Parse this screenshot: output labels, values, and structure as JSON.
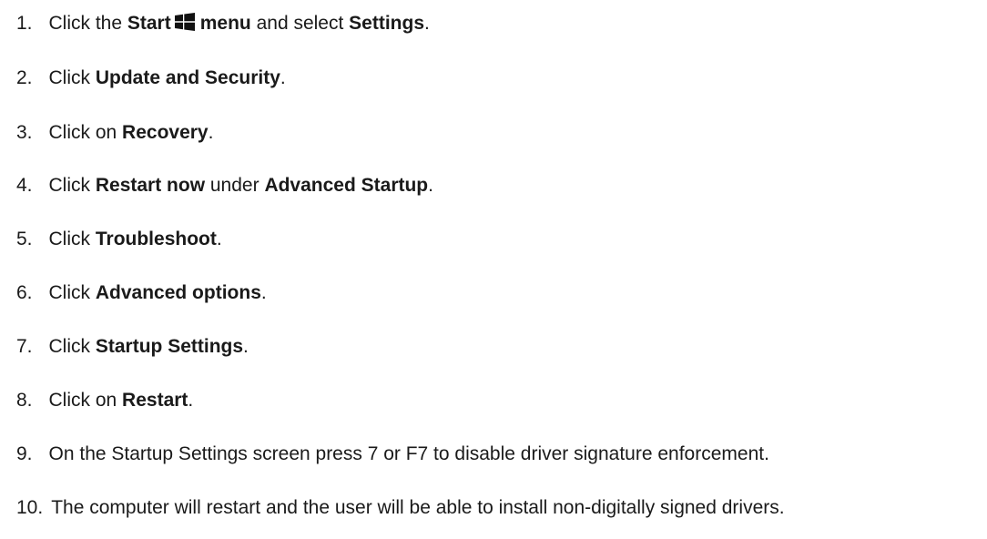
{
  "steps": [
    {
      "number": "1.",
      "parts": [
        {
          "text": "Click the ",
          "bold": false
        },
        {
          "text": "Start",
          "bold": true
        },
        {
          "icon": "windows-logo-icon"
        },
        {
          "text": "menu",
          "bold": true
        },
        {
          "text": " and select ",
          "bold": false
        },
        {
          "text": "Settings",
          "bold": true
        },
        {
          "text": ".",
          "bold": false
        }
      ]
    },
    {
      "number": "2.",
      "parts": [
        {
          "text": "Click ",
          "bold": false
        },
        {
          "text": "Update and Security",
          "bold": true
        },
        {
          "text": ".",
          "bold": false
        }
      ]
    },
    {
      "number": "3.",
      "parts": [
        {
          "text": "Click on ",
          "bold": false
        },
        {
          "text": "Recovery",
          "bold": true
        },
        {
          "text": ".",
          "bold": false
        }
      ]
    },
    {
      "number": "4.",
      "parts": [
        {
          "text": "Click ",
          "bold": false
        },
        {
          "text": "Restart now",
          "bold": true
        },
        {
          "text": " under ",
          "bold": false
        },
        {
          "text": "Advanced Startup",
          "bold": true
        },
        {
          "text": ".",
          "bold": false
        }
      ]
    },
    {
      "number": "5.",
      "parts": [
        {
          "text": "Click ",
          "bold": false
        },
        {
          "text": "Troubleshoot",
          "bold": true
        },
        {
          "text": ".",
          "bold": false
        }
      ]
    },
    {
      "number": "6.",
      "parts": [
        {
          "text": "Click ",
          "bold": false
        },
        {
          "text": "Advanced options",
          "bold": true
        },
        {
          "text": ".",
          "bold": false
        }
      ]
    },
    {
      "number": "7.",
      "parts": [
        {
          "text": "Click ",
          "bold": false
        },
        {
          "text": "Startup Settings",
          "bold": true
        },
        {
          "text": ".",
          "bold": false
        }
      ]
    },
    {
      "number": "8.",
      "parts": [
        {
          "text": "Click on ",
          "bold": false
        },
        {
          "text": "Restart",
          "bold": true
        },
        {
          "text": ".",
          "bold": false
        }
      ]
    },
    {
      "number": "9.",
      "parts": [
        {
          "text": "On the Startup Settings screen press 7 or F7 to disable driver signature enforcement.",
          "bold": false
        }
      ]
    },
    {
      "number": "10.",
      "parts": [
        {
          "text": "The computer will restart and the user will be able to install non-digitally signed drivers.",
          "bold": false
        }
      ]
    }
  ]
}
